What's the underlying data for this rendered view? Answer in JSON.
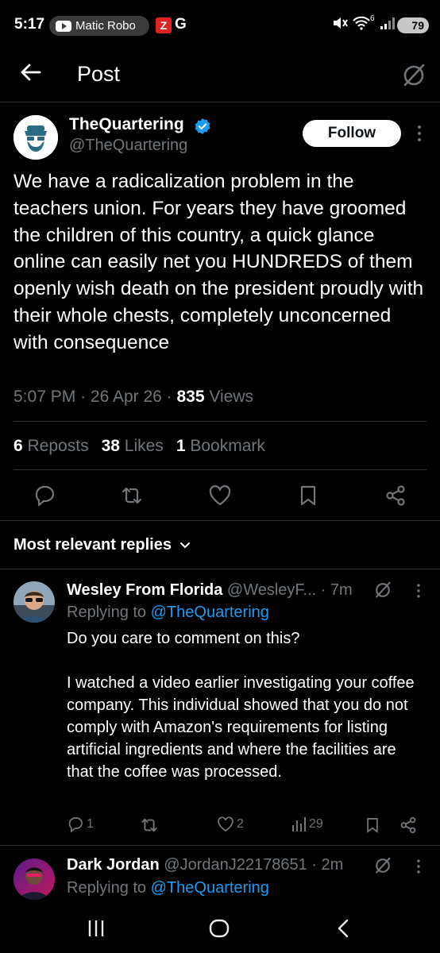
{
  "status_bar": {
    "time": "5:17",
    "app_pill": "Matic Robo",
    "z_badge": "Z",
    "g_label": "G",
    "signal": "6",
    "battery": "79"
  },
  "header": {
    "title": "Post"
  },
  "post": {
    "author_name": "TheQuartering",
    "author_handle": "@TheQuartering",
    "follow_label": "Follow",
    "text": "We have a radicalization problem in the teachers union.  For years they have groomed the children of this country, a quick glance online can easily net you HUNDREDS of them openly wish death on the president proudly with their whole chests, completely unconcerned with consequence",
    "time": "5:07 PM",
    "date": "26 Apr 26",
    "views_count": "835",
    "views_label": "Views",
    "sep": "·",
    "reposts_count": "6",
    "reposts_label": "Reposts",
    "likes_count": "38",
    "likes_label": "Likes",
    "bookmarks_count": "1",
    "bookmarks_label": "Bookmark"
  },
  "replies_header": {
    "label": "Most relevant replies"
  },
  "replies": [
    {
      "name": "Wesley From Florida",
      "handle": "@WesleyF...",
      "time": "· 7m",
      "replying_prefix": "Replying to",
      "replying_to": "@TheQuartering",
      "text": "Do you care to comment on this?\n\nI watched a video earlier investigating your coffee company. This individual showed that you do not comply with Amazon's requirements for listing artificial ingredients and where the facilities are that the coffee was processed.",
      "replies": "1",
      "likes": "2",
      "views": "29"
    },
    {
      "name": "Dark Jordan",
      "handle": "@JordanJ22178651",
      "time": "· 2m",
      "replying_prefix": "Replying to",
      "replying_to": "@TheQuartering"
    }
  ],
  "colors": {
    "background": "#000000",
    "text": "#e7e9ea",
    "muted": "#71767b",
    "link": "#1d9bf0",
    "verified": "#1d9bf0"
  }
}
